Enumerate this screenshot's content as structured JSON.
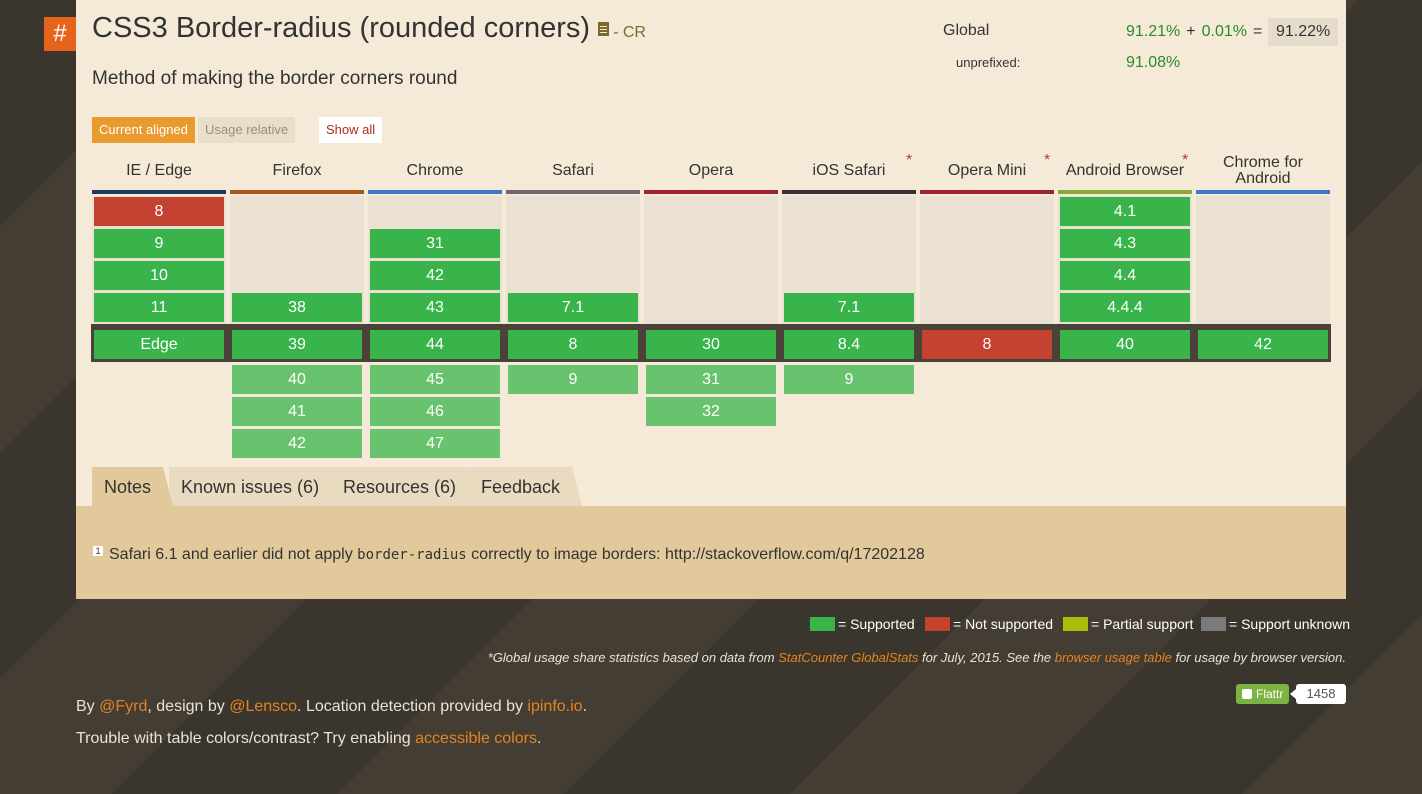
{
  "feature": {
    "hash": "#",
    "title": "CSS3 Border-radius (rounded corners)",
    "status": "- CR",
    "description": "Method of making the border corners round"
  },
  "usage": {
    "global_label": "Global",
    "supported": "91.21%",
    "plus": "+",
    "partial": "0.01%",
    "equals": "=",
    "total": "91.22%",
    "unprefixed_label": "unprefixed:",
    "unprefixed": "91.08%"
  },
  "view_buttons": {
    "aligned": "Current aligned",
    "relative": "Usage relative",
    "show_all": "Show all"
  },
  "browsers": [
    {
      "name": "IE / Edge",
      "bar_color": "#1f3a5f",
      "star": false,
      "cells": [
        {
          "v": "8",
          "s": "n"
        },
        {
          "v": "9",
          "s": "y"
        },
        {
          "v": "10",
          "s": "y"
        },
        {
          "v": "11",
          "s": "y"
        }
      ],
      "current": {
        "v": "Edge",
        "s": "y"
      },
      "future": []
    },
    {
      "name": "Firefox",
      "bar_color": "#a9581d",
      "star": false,
      "cells": [
        null,
        null,
        null,
        {
          "v": "38",
          "s": "y"
        }
      ],
      "current": {
        "v": "39",
        "s": "y"
      },
      "future": [
        {
          "v": "40",
          "s": "f"
        },
        {
          "v": "41",
          "s": "f"
        },
        {
          "v": "42",
          "s": "f"
        }
      ]
    },
    {
      "name": "Chrome",
      "bar_color": "#3b78c6",
      "star": false,
      "cells": [
        null,
        {
          "v": "31",
          "s": "y"
        },
        {
          "v": "42",
          "s": "y"
        },
        {
          "v": "43",
          "s": "y"
        }
      ],
      "current": {
        "v": "44",
        "s": "y"
      },
      "future": [
        {
          "v": "45",
          "s": "f"
        },
        {
          "v": "46",
          "s": "f"
        },
        {
          "v": "47",
          "s": "f"
        }
      ]
    },
    {
      "name": "Safari",
      "bar_color": "#6b6b6b",
      "star": false,
      "cells": [
        null,
        null,
        null,
        {
          "v": "7.1",
          "s": "y"
        }
      ],
      "current": {
        "v": "8",
        "s": "y"
      },
      "future": [
        {
          "v": "9",
          "s": "f"
        }
      ]
    },
    {
      "name": "Opera",
      "bar_color": "#a0232a",
      "star": false,
      "cells": [
        null,
        null,
        null,
        null
      ],
      "current": {
        "v": "30",
        "s": "y"
      },
      "future": [
        {
          "v": "31",
          "s": "f"
        },
        {
          "v": "32",
          "s": "f"
        }
      ]
    },
    {
      "name": "iOS Safari",
      "bar_color": "#333333",
      "star": true,
      "cells": [
        null,
        null,
        null,
        {
          "v": "7.1",
          "s": "y"
        }
      ],
      "current": {
        "v": "8.4",
        "s": "y"
      },
      "future": [
        {
          "v": "9",
          "s": "f"
        }
      ]
    },
    {
      "name": "Opera Mini",
      "bar_color": "#a0232a",
      "star": true,
      "cells": [
        null,
        null,
        null,
        null
      ],
      "current": {
        "v": "8",
        "s": "n"
      },
      "future": []
    },
    {
      "name": "Android Browser",
      "bar_color": "#8aa63a",
      "star": true,
      "cells": [
        {
          "v": "4.1",
          "s": "y"
        },
        {
          "v": "4.3",
          "s": "y"
        },
        {
          "v": "4.4",
          "s": "y"
        },
        {
          "v": "4.4.4",
          "s": "y"
        }
      ],
      "current": {
        "v": "40",
        "s": "y"
      },
      "future": []
    },
    {
      "name": "Chrome for Android",
      "bar_color": "#3b78c6",
      "star": false,
      "cells": [
        null,
        null,
        null,
        null
      ],
      "current": {
        "v": "42",
        "s": "y"
      },
      "future": []
    }
  ],
  "tabs": [
    {
      "label": "Notes",
      "active": true
    },
    {
      "label": "Known issues (6)",
      "active": false
    },
    {
      "label": "Resources (6)",
      "active": false
    },
    {
      "label": "Feedback",
      "active": false
    }
  ],
  "note": {
    "num": "1",
    "before": "Safari 6.1 and earlier did not apply ",
    "code": "border-radius",
    "after": " correctly to image borders: http://stackoverflow.com/q/17202128"
  },
  "legend": [
    {
      "label": "= Supported",
      "color": "#38b44a"
    },
    {
      "label": "= Not supported",
      "color": "#c44230"
    },
    {
      "label": "= Partial support",
      "color": "#a8be0a"
    },
    {
      "label": "= Support unknown",
      "color": "#7a7a7a"
    }
  ],
  "footnote": {
    "t1": "*Global usage share statistics based on data from ",
    "l1": "StatCounter GlobalStats",
    "t2": " for July, 2015. See the ",
    "l2": "browser usage table",
    "t3": " for usage by browser version."
  },
  "credits": {
    "by": "By ",
    "fyrd": "@Fyrd",
    "design": ", design by ",
    "lensco": "@Lensco",
    "location": ". Location detection provided by ",
    "ipinfo": "ipinfo.io",
    "end": ".",
    "trouble": "Trouble with table colors/contrast? Try enabling ",
    "accessible": "accessible colors",
    "end2": "."
  },
  "flattr": {
    "label": "Flattr",
    "count": "1458"
  }
}
